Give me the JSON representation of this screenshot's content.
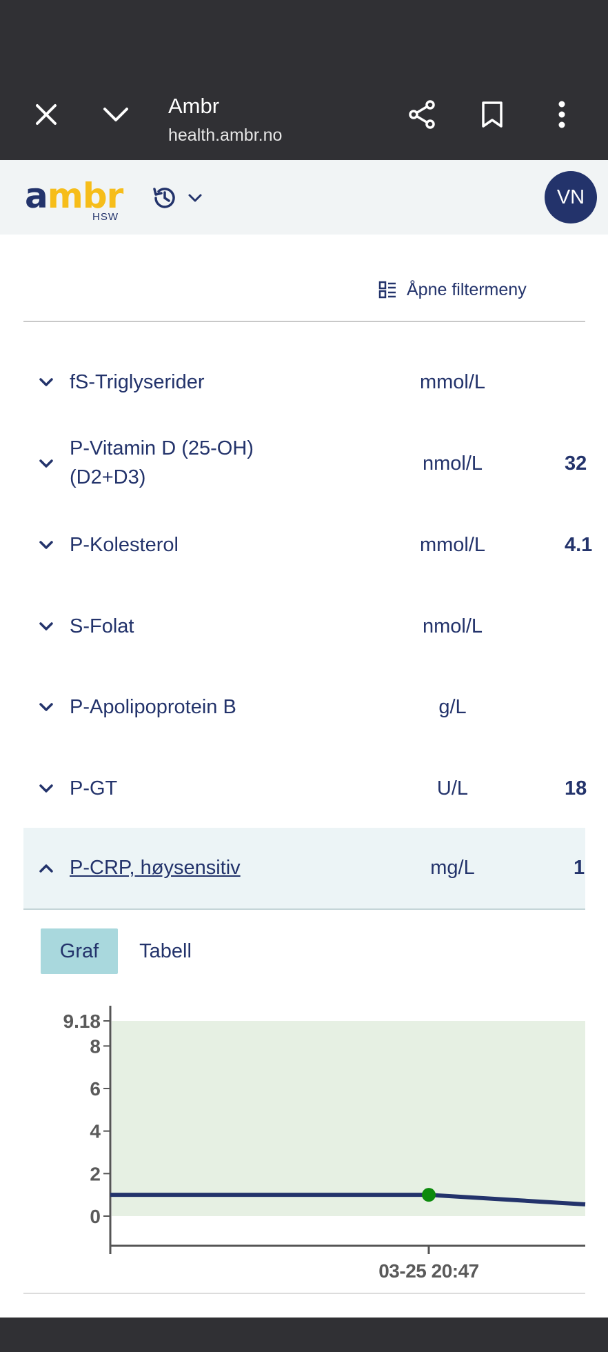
{
  "browser": {
    "title": "Ambr",
    "url": "health.ambr.no"
  },
  "header": {
    "logo_main_a": "a",
    "logo_main_rest": "mbr",
    "logo_sub": "HSW",
    "avatar_initials": "VN"
  },
  "filter": {
    "label": "Åpne filtermeny"
  },
  "rows": [
    {
      "name": "fS-Triglyserider",
      "unit": "mmol/L",
      "value": ""
    },
    {
      "name": "P-Vitamin D (25-OH)",
      "name2": "(D2+D3)",
      "unit": "nmol/L",
      "value": "32"
    },
    {
      "name": "P-Kolesterol",
      "unit": "mmol/L",
      "value": "4.1"
    },
    {
      "name": "S-Folat",
      "unit": "nmol/L",
      "value": ""
    },
    {
      "name": "P-Apolipoprotein B",
      "unit": "g/L",
      "value": ""
    },
    {
      "name": "P-GT",
      "unit": "U/L",
      "value": "18"
    },
    {
      "name": "P-CRP, høysensitiv",
      "unit": "mg/L",
      "value": "1"
    }
  ],
  "tabs": {
    "graf": "Graf",
    "tabell": "Tabell"
  },
  "chart_data": {
    "type": "line",
    "yticks": [
      "9.18",
      "8",
      "6",
      "4",
      "2",
      "0"
    ],
    "ylim": [
      0,
      9.18
    ],
    "reference_range": [
      0,
      9.18
    ],
    "x_label": "03-25 20:47",
    "series": [
      {
        "values": [
          1,
          1,
          0.55
        ]
      }
    ],
    "highlight_point": {
      "x": "03-25 20:47",
      "y": 1
    },
    "colors": {
      "line": "#23336b",
      "point": "#0c8a0c",
      "band": "#e6f0e3",
      "axis": "#555555"
    }
  }
}
